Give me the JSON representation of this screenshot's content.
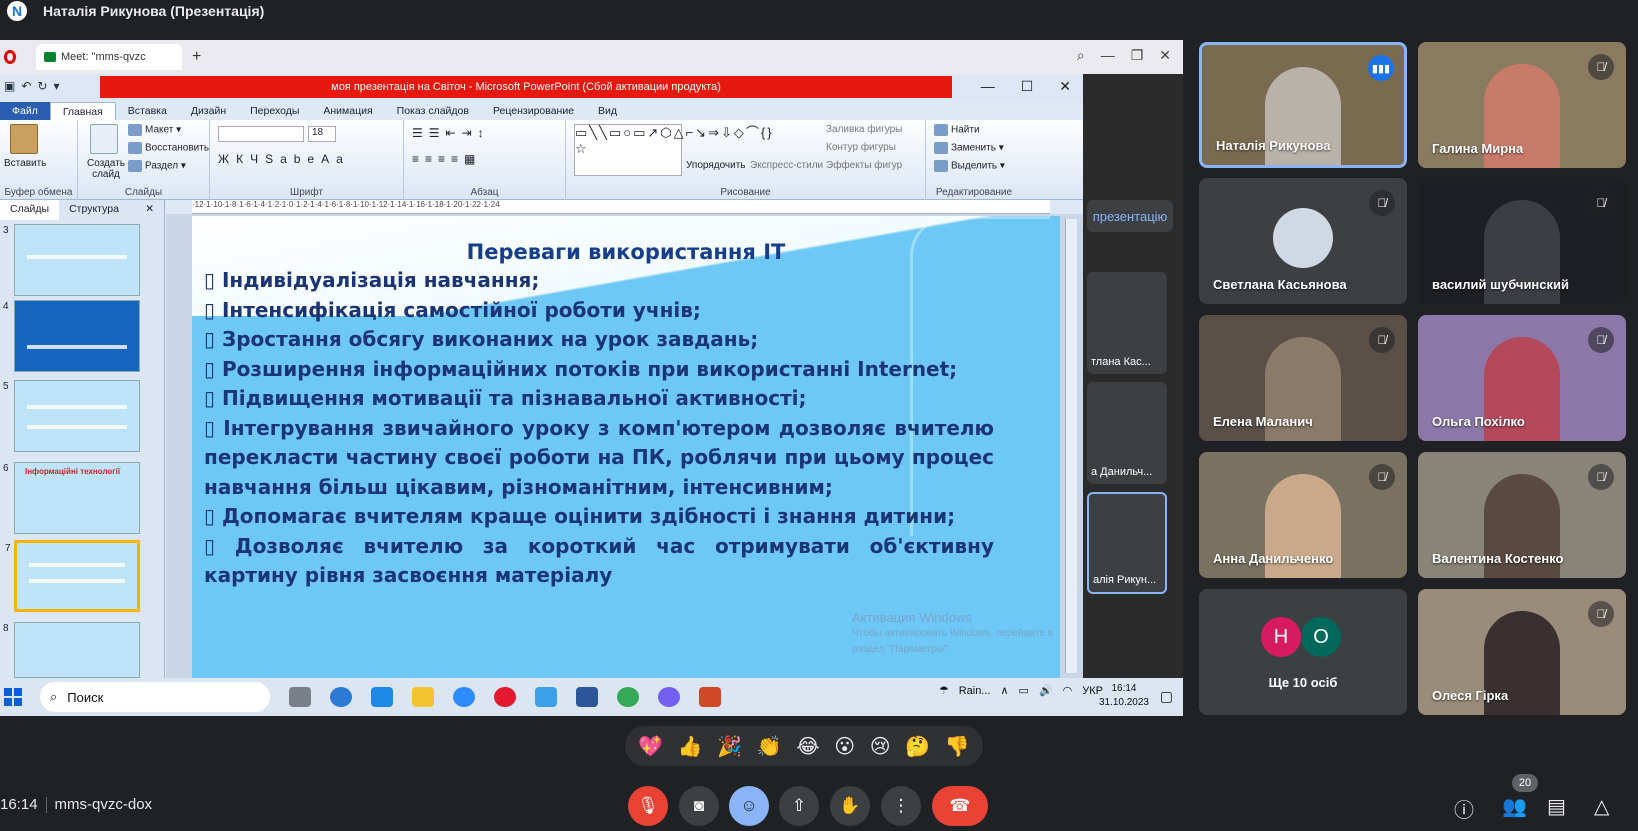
{
  "top_bar": {
    "logo_letter": "N",
    "title": "Наталія Рикунова (Презентація)"
  },
  "browser": {
    "tab_label": "Meet: \"mms-qvzc",
    "new_tab": "+"
  },
  "powerpoint": {
    "window_title": "моя презентація на Світоч  -  Microsoft PowerPoint (Сбой активации продукта)",
    "tabs": [
      "Файл",
      "Главная",
      "Вставка",
      "Дизайн",
      "Переходы",
      "Анимация",
      "Показ слайдов",
      "Рецензирование",
      "Вид"
    ],
    "active_tab_index": 1,
    "ribbon": {
      "clipboard": {
        "paste": "Вставить",
        "group": "Буфер обмена"
      },
      "slides": {
        "new_slide": "Создать слайд",
        "layout": "Макет",
        "reset": "Восстановить",
        "section": "Раздел",
        "group": "Слайды"
      },
      "font": {
        "size": "18",
        "group": "Шрифт"
      },
      "paragraph": {
        "group": "Абзац"
      },
      "drawing": {
        "arrange": "Упорядочить",
        "quick_styles": "Экспресс-стили",
        "fill": "Заливка фигуры",
        "outline": "Контур фигуры",
        "effects": "Эффекты фигур",
        "group": "Рисование"
      },
      "editing": {
        "find": "Найти",
        "replace": "Заменить",
        "select": "Выделить",
        "group": "Редактирование"
      }
    },
    "panel_tabs": [
      "Слайды",
      "Структура"
    ],
    "slide_numbers": [
      "3",
      "4",
      "5",
      "6",
      "7",
      "8"
    ],
    "selected_slide": "7",
    "thumb6_title": "Інформаційні технології",
    "ruler_text": "·12·1·10·1·8·1·6·1·4·1·2·1·0·1·2·1·4·1·6·1·8·1·10·1·12·1·14·1·16·1·18·1·20·1·22·1·24",
    "slide": {
      "title": "Переваги використання ІТ",
      "bullets": [
        " Індивідуалізація навчання;",
        " Інтенсифікація самостійної роботи учнів;",
        " Зростання обсягу виконаних на урок завдань;",
        " Розширення інформаційних потоків при використанні Internet;",
        " Підвищення мотивації та пізнавальної активності;",
        " Інтегрування звичайного уроку з комп'ютером дозволяє вчителю перекласти частину своєї роботи на ПК, роблячи при цьому процес навчання більш цікавим, різноманітним, інтенсивним;",
        " Допомагає вчителям краще оцінити здібності і знання дитини;",
        " Дозволяє вчителю за короткий час отримувати об'єктивну картину рівня засвоєння матеріалу"
      ],
      "bullet_glyph": "▯"
    },
    "watermark": {
      "line1": "Активация Windows",
      "line2": "Чтобы активировать Windows, перейдите в",
      "line3": "раздел \"Параметры\"."
    }
  },
  "taskbar": {
    "search_placeholder": "Поиск",
    "weather": "Rain...",
    "lang": "УКР",
    "time": "16:14",
    "date": "31.10.2023"
  },
  "meet_sidebar": {
    "present_button": "презентацію",
    "mini_tiles": [
      "тлана Кас...",
      "а Данильч...",
      "алія Рикун..."
    ]
  },
  "participants": [
    {
      "name": "Наталія Рикунова",
      "speaking": true
    },
    {
      "name": "Галина Мирна",
      "speaking": false
    },
    {
      "name": "Светлана Касьянова",
      "speaking": false
    },
    {
      "name": "василий шубчинский",
      "speaking": false
    },
    {
      "name": "Елена Маланич",
      "speaking": false
    },
    {
      "name": "Ольга Похілко",
      "speaking": false
    },
    {
      "name": "Анна Данильченко",
      "speaking": false
    },
    {
      "name": "Валентина Костенко",
      "speaking": false
    },
    {
      "name": "Олеся Гірка",
      "speaking": false
    }
  ],
  "others_tile": {
    "label": "Ще 10 осіб",
    "initials": [
      "Н",
      "О"
    ],
    "colors": [
      "#d81b60",
      "#00695c"
    ]
  },
  "reactions": [
    "💖",
    "👍",
    "🎉",
    "👏",
    "😂",
    "😮",
    "😢",
    "🤔",
    "👎"
  ],
  "bottom": {
    "time": "16:14",
    "meeting_code": "mms-qvzc-dox",
    "participant_count": "20"
  },
  "colors": {
    "accent": "#8ab4f8",
    "end_call": "#ea4335",
    "bg": "#202124"
  }
}
